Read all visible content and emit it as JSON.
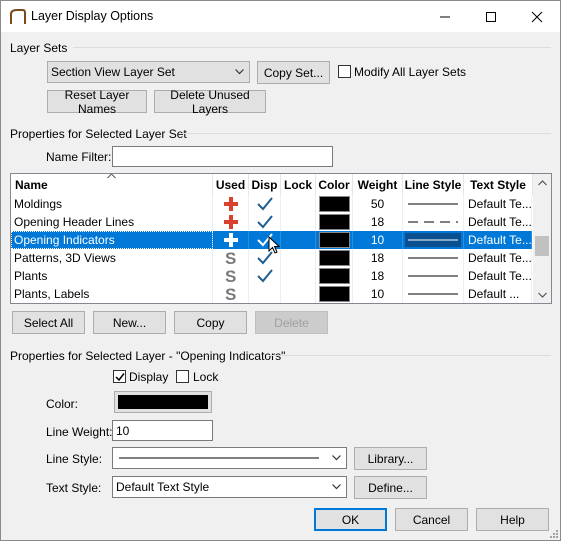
{
  "window": {
    "title": "Layer Display Options"
  },
  "layer_sets": {
    "group_label": "Layer Sets",
    "selected_set": "Section View Layer Set",
    "copy_set_label": "Copy Set...",
    "modify_all_label": "Modify All Layer Sets",
    "modify_all_checked": false,
    "reset_label": "Reset Layer Names",
    "delete_unused_label": "Delete Unused Layers"
  },
  "properties_set": {
    "group_label": "Properties for Selected Layer Set",
    "name_filter_label": "Name Filter:",
    "name_filter_value": ""
  },
  "table": {
    "columns": [
      "Name",
      "Used",
      "Disp",
      "Lock",
      "Color",
      "Weight",
      "Line Style",
      "Text Style"
    ],
    "rows": [
      {
        "name": "Moldings",
        "used": "plus",
        "disp": true,
        "lock": false,
        "color": "#000000",
        "weight": "50",
        "line": "solid",
        "text": "Default Te...",
        "selected": false
      },
      {
        "name": "Opening Header Lines",
        "used": "plus",
        "disp": true,
        "lock": false,
        "color": "#000000",
        "weight": "18",
        "line": "dashed",
        "text": "Default Te...",
        "selected": false
      },
      {
        "name": "Opening Indicators",
        "used": "plus",
        "disp": true,
        "lock": false,
        "color": "#000000",
        "weight": "10",
        "line": "solid",
        "text": "Default Te...",
        "selected": true
      },
      {
        "name": "Patterns, 3D Views",
        "used": "S",
        "disp": true,
        "lock": false,
        "color": "#000000",
        "weight": "18",
        "line": "solid",
        "text": "Default Te...",
        "selected": false
      },
      {
        "name": "Plants",
        "used": "S",
        "disp": true,
        "lock": false,
        "color": "#000000",
        "weight": "18",
        "line": "solid",
        "text": "Default Te...",
        "selected": false
      },
      {
        "name": "Plants, Labels",
        "used": "S",
        "disp": false,
        "lock": false,
        "color": "#000000",
        "weight": "10",
        "line": "solid",
        "text": "Default ...",
        "selected": false
      }
    ]
  },
  "table_buttons": {
    "select_all": "Select All",
    "new": "New...",
    "copy": "Copy",
    "delete": "Delete"
  },
  "properties_layer": {
    "group_label": "Properties for Selected Layer - \"Opening Indicators\"",
    "display_label": "Display",
    "display_checked": true,
    "lock_label": "Lock",
    "lock_checked": false,
    "color_label": "Color:",
    "color_value": "#000000",
    "line_weight_label": "Line Weight:",
    "line_weight_value": "10",
    "line_style_label": "Line Style:",
    "library_label": "Library...",
    "text_style_label": "Text Style:",
    "text_style_value": "Default Text Style",
    "define_label": "Define..."
  },
  "footer": {
    "ok": "OK",
    "cancel": "Cancel",
    "help": "Help"
  },
  "colors": {
    "selection": "#0078d7",
    "plus": "#d9412f",
    "check": "#1f5f8f",
    "s_icon": "#7a7a7a"
  }
}
